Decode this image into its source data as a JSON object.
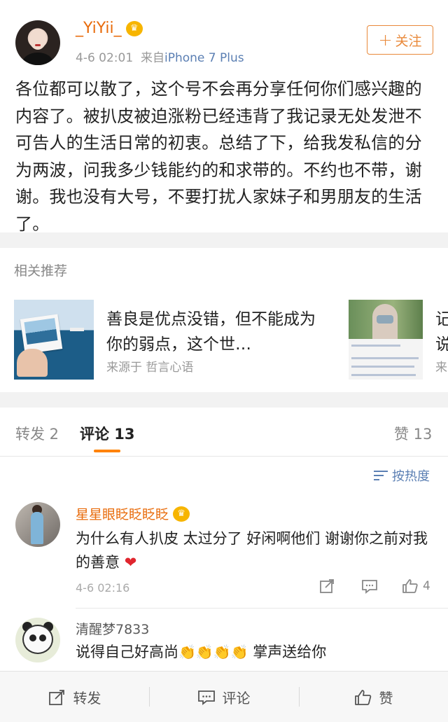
{
  "post": {
    "username": "_YiYii_",
    "vip_badge": "♛",
    "time": "4-6 02:01",
    "source_prefix": "来自",
    "source": "iPhone 7 Plus",
    "follow_label": "关注",
    "text": "各位都可以散了，这个号不会再分享任何你们感兴趣的内容了。被扒皮被迫涨粉已经违背了我记录无处发泄不可告人的生活日常的初衷。总结了下，给我发私信的分为两波，问我多少钱能约的和求带的。不约也不带，谢谢。我也没有大号，不要打扰人家妹子和男朋友的生活了。"
  },
  "recommendations": {
    "title": "相关推荐",
    "items": [
      {
        "text": "善良是优点没错，但不能成为你的弱点，这个世…",
        "source": "来源于 哲言心语"
      },
      {
        "text": "记说",
        "source": "来"
      }
    ]
  },
  "tabs": {
    "repost": "转发 2",
    "comment": "评论 13",
    "like": "赞 13",
    "sort": "按热度"
  },
  "comments": [
    {
      "name": "星星眼眨眨眨眨",
      "badge": "♛",
      "text": "为什么有人扒皮 太过分了 好闲啊他们 谢谢你之前对我的善意",
      "emoji": "❤",
      "time": "4-6 02:16",
      "likes": "4"
    },
    {
      "name": "清醒梦7833",
      "text": "说得自己好高尚",
      "emoji": "👏👏👏👏",
      "suffix": "掌声送给你"
    }
  ],
  "bottom_bar": {
    "repost": "转发",
    "comment": "评论",
    "like": "赞"
  },
  "colors": {
    "accent_orange": "#ff8200",
    "vip_name": "#e86b0b",
    "link_blue": "#5b7fb3",
    "heart_red": "#e0262e"
  }
}
